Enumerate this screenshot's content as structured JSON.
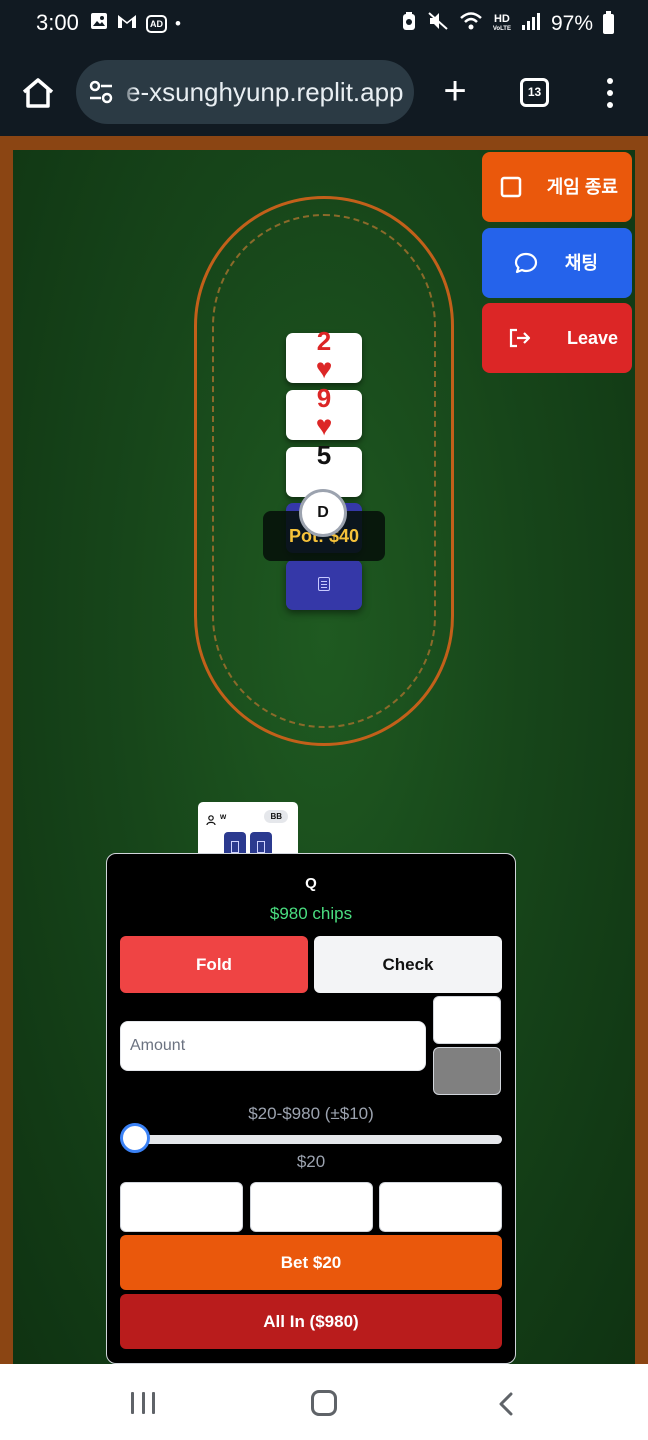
{
  "status_bar": {
    "time": "3:00",
    "left_icons": [
      "gallery-icon",
      "gmail-icon",
      "ad-blocker-icon",
      "dot-icon"
    ],
    "ad_label": "AD",
    "hd_label": "HD",
    "hd_sub": "VoLTE",
    "battery": "97%"
  },
  "browser": {
    "url": "e-xsunghyunp.replit.app",
    "tab_count": "13"
  },
  "table": {
    "community_cards": [
      {
        "rank": "2",
        "suit": "♥",
        "color": "#dc2626"
      },
      {
        "rank": "9",
        "suit": "♥",
        "color": "#dc2626"
      },
      {
        "rank": "5",
        "suit": "",
        "color": "#111111"
      }
    ],
    "pot": "Pot: $40",
    "dealer": "D"
  },
  "side_buttons": {
    "end_game": "게임 종료",
    "chat": "채팅",
    "leave": "Leave"
  },
  "player_tile": {
    "name": "w",
    "badge": "BB"
  },
  "action_panel": {
    "player_name": "Q",
    "chips": "$980 chips",
    "fold": "Fold",
    "check": "Check",
    "amount_placeholder": "Amount",
    "range": "$20-$980 (±$10)",
    "current_value": "$20",
    "bet": "Bet $20",
    "all_in": "All In ($980)",
    "slider_fraction": 0.0
  },
  "colors": {
    "felt": "#17461a",
    "wood": "#8b4513",
    "orange": "#ea580c",
    "blue": "#2563eb",
    "red": "#dc2626"
  }
}
